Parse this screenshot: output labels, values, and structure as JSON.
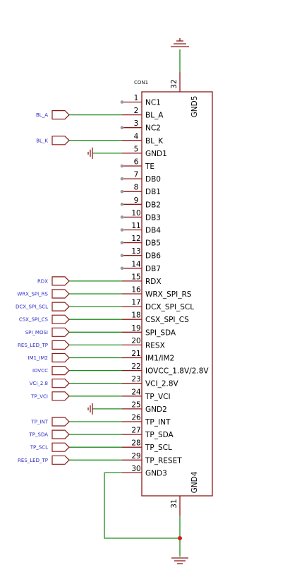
{
  "component": {
    "ref": "CON1",
    "pins": [
      {
        "num": "1",
        "name": "NC1",
        "net": null,
        "nc": true
      },
      {
        "num": "2",
        "name": "BL_A",
        "net": "BL_A"
      },
      {
        "num": "3",
        "name": "NC2",
        "net": null,
        "nc": true
      },
      {
        "num": "4",
        "name": "BL_K",
        "net": "BL_K"
      },
      {
        "num": "5",
        "name": "GND1",
        "net": null,
        "gnd": true
      },
      {
        "num": "6",
        "name": "TE",
        "net": null,
        "nc": true
      },
      {
        "num": "7",
        "name": "DB0",
        "net": null,
        "nc": true
      },
      {
        "num": "8",
        "name": "DB1",
        "net": null,
        "nc": true
      },
      {
        "num": "9",
        "name": "DB2",
        "net": null,
        "nc": true
      },
      {
        "num": "10",
        "name": "DB3",
        "net": null,
        "nc": true
      },
      {
        "num": "11",
        "name": "DB4",
        "net": null,
        "nc": true
      },
      {
        "num": "12",
        "name": "DB5",
        "net": null,
        "nc": true
      },
      {
        "num": "13",
        "name": "DB6",
        "net": null,
        "nc": true
      },
      {
        "num": "14",
        "name": "DB7",
        "net": null,
        "nc": true
      },
      {
        "num": "15",
        "name": "RDX",
        "net": "RDX"
      },
      {
        "num": "16",
        "name": "WRX_SPI_RS",
        "net": "WRX_SPI_RS"
      },
      {
        "num": "17",
        "name": "DCX_SPI_SCL",
        "net": "DCX_SPI_SCL"
      },
      {
        "num": "18",
        "name": "CSX_SPI_CS",
        "net": "CSX_SPI_CS"
      },
      {
        "num": "19",
        "name": "SPI_SDA",
        "net": "SPI_MOSI"
      },
      {
        "num": "20",
        "name": "RESX",
        "net": "RES_LED_TP"
      },
      {
        "num": "21",
        "name": "IM1/IM2",
        "net": "IM1_IM2"
      },
      {
        "num": "22",
        "name": "IOVCC_1.8V/2.8V",
        "net": "IOVCC"
      },
      {
        "num": "23",
        "name": "VCI_2.8V",
        "net": "VCI_2.8"
      },
      {
        "num": "24",
        "name": "TP_VCI",
        "net": "TP_VCI"
      },
      {
        "num": "25",
        "name": "GND2",
        "net": null,
        "gnd": true
      },
      {
        "num": "26",
        "name": "TP_INT",
        "net": "TP_INT"
      },
      {
        "num": "27",
        "name": "TP_SDA",
        "net": "TP_SDA"
      },
      {
        "num": "28",
        "name": "TP_SCL",
        "net": "TP_SCL"
      },
      {
        "num": "29",
        "name": "TP_RESET",
        "net": "RES_LED_TP"
      },
      {
        "num": "30",
        "name": "GND3",
        "net": null,
        "gnd_loop": true
      }
    ],
    "top_pin": {
      "num": "32",
      "name": "GND5"
    },
    "bottom_pin": {
      "num": "31",
      "name": "GND4"
    }
  },
  "colors": {
    "component": "#8b1a1a",
    "wire": "#1e8c1e",
    "net_label": "#2b2bc8",
    "junction": "#d61f1f",
    "nc_dot": "#9a9a9a"
  }
}
